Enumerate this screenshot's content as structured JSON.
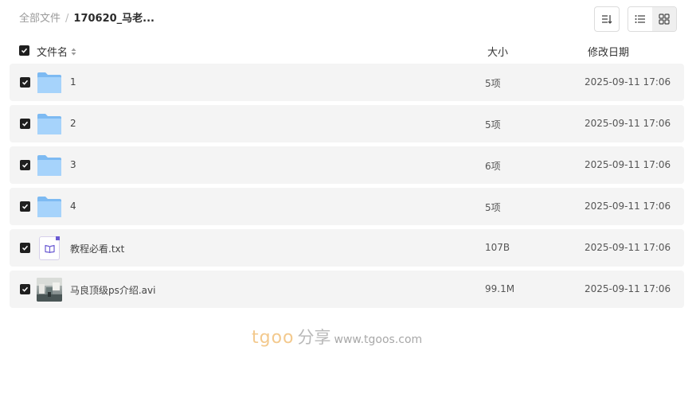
{
  "breadcrumb": {
    "root": "全部文件",
    "separator": "/",
    "current": "170620_马老..."
  },
  "toolbar": {
    "sort_icon": "sort-icon",
    "list_view_icon": "list-view-icon",
    "grid_view_icon": "grid-view-icon"
  },
  "header": {
    "name": "文件名",
    "size": "大小",
    "date": "修改日期"
  },
  "files": [
    {
      "name": "1",
      "size": "5项",
      "date": "2025-09-11 17:06",
      "type": "folder"
    },
    {
      "name": "2",
      "size": "5项",
      "date": "2025-09-11 17:06",
      "type": "folder"
    },
    {
      "name": "3",
      "size": "6项",
      "date": "2025-09-11 17:06",
      "type": "folder"
    },
    {
      "name": "4",
      "size": "5项",
      "date": "2025-09-11 17:06",
      "type": "folder"
    },
    {
      "name": "教程必看.txt",
      "size": "107B",
      "date": "2025-09-11 17:06",
      "type": "txt"
    },
    {
      "name": "马良顶级ps介绍.avi",
      "size": "99.1M",
      "date": "2025-09-11 17:06",
      "type": "video"
    }
  ],
  "watermark": {
    "brand": "tgoo",
    "share": "分享",
    "url": "www.tgoos.com"
  },
  "colors": {
    "folder": "#8cc4f7",
    "row_bg": "#f4f4f4",
    "checkbox": "#1f1f1f",
    "txt_accent": "#6b5bd2"
  }
}
